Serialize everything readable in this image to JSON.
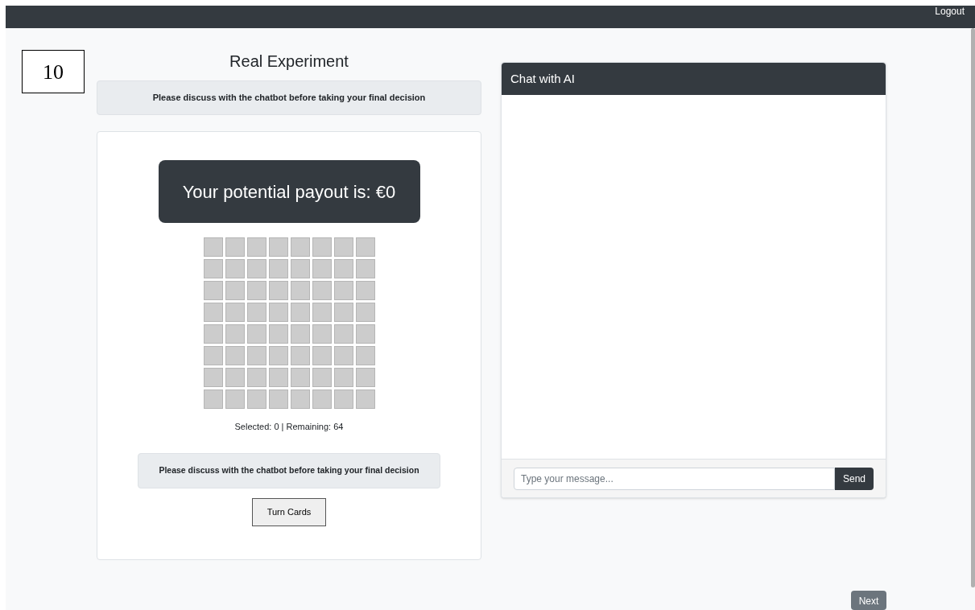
{
  "navbar": {
    "logout": "Logout"
  },
  "figure_label": "10",
  "game": {
    "title": "Real Experiment",
    "top_notice": "Please discuss with the chatbot before taking your final decision",
    "payout": "Your potential payout is: €0",
    "status": "Selected: 0 | Remaining: 64",
    "bottom_notice": "Please discuss with the chatbot before taking your final decision",
    "turn_button": "Turn Cards"
  },
  "chat": {
    "title": "Chat with AI",
    "placeholder": "Type your message...",
    "send": "Send"
  },
  "next_button": "Next"
}
